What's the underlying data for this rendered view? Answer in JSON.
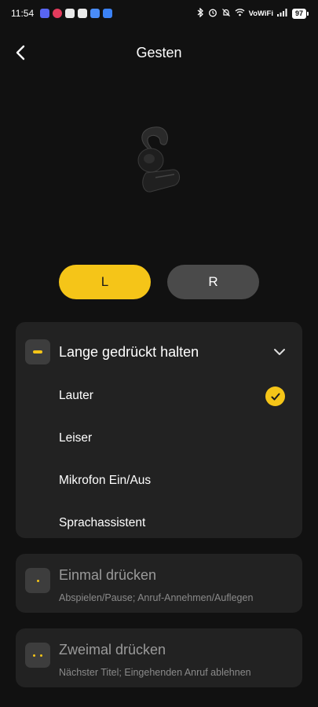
{
  "status_bar": {
    "time": "11:54",
    "network": "VoWiFi",
    "battery": "97",
    "app_icons": [
      {
        "name": "discord-icon",
        "color": "#5865F2"
      },
      {
        "name": "notification-app-icon",
        "color": "#e23b5c"
      },
      {
        "name": "youtube-icon",
        "color": "#e9e9e9"
      },
      {
        "name": "gmail-icon",
        "color": "#eaeaea"
      },
      {
        "name": "drive-icon",
        "color": "#4a8cf7"
      },
      {
        "name": "outlook-icon",
        "color": "#3b82f6"
      }
    ]
  },
  "header": {
    "title": "Gesten"
  },
  "side_toggle": {
    "left_label": "L",
    "right_label": "R",
    "selected": "L"
  },
  "gestures": {
    "long_press": {
      "title": "Lange gedrückt halten",
      "options": [
        "Lauter",
        "Leiser",
        "Mikrofon Ein/Aus",
        "Sprachassistent"
      ],
      "selected": "Lauter"
    },
    "single_press": {
      "title": "Einmal drücken",
      "description": "Abspielen/Pause; Anruf-Annehmen/Auflegen"
    },
    "double_press": {
      "title": "Zweimal drücken",
      "description": "Nächster Titel; Eingehenden Anruf ablehnen"
    }
  },
  "colors": {
    "accent": "#f5c518",
    "background": "#111111",
    "card": "#222222",
    "toggle_inactive": "#4a4a4a"
  }
}
